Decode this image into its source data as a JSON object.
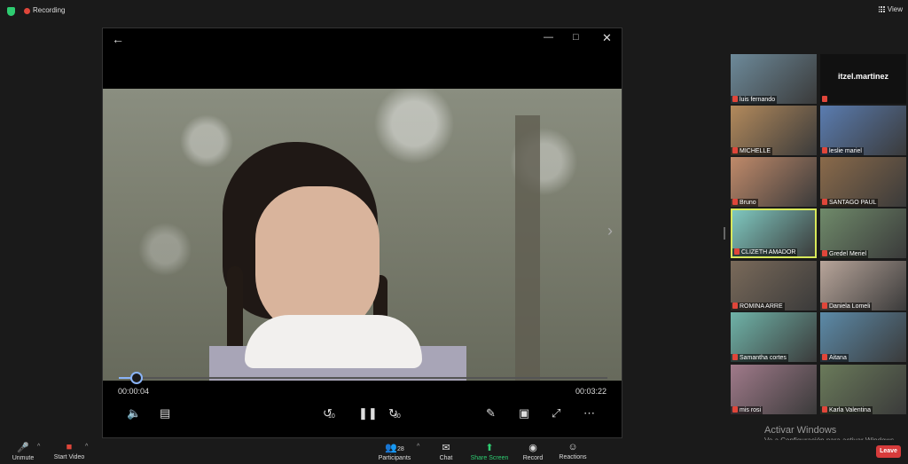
{
  "topbar": {
    "recording_label": "Recording",
    "view_label": "View"
  },
  "player": {
    "time_current": "00:00:04",
    "time_total": "00:03:22",
    "progress_fraction": 0.034,
    "skip_back_label": "10",
    "skip_forward_label": "30"
  },
  "gallery": [
    {
      "name": "luis fernando",
      "color": "#6d8a9a"
    },
    {
      "name": "itzel.martinez",
      "color": "#1a1a1a",
      "no_video": true
    },
    {
      "name": "MICHELLE",
      "color": "#b38a5c"
    },
    {
      "name": "leslie mariel",
      "color": "#5a7cb0"
    },
    {
      "name": "Bruno",
      "color": "#c08a6a"
    },
    {
      "name": "SANTAGO PAUL",
      "color": "#8a6a4a"
    },
    {
      "name": "CLIZETH AMADOR",
      "color": "#7fc8c0",
      "active": true
    },
    {
      "name": "Gredel Meriel",
      "color": "#6f8a6a"
    },
    {
      "name": "ROMINA ARRE",
      "color": "#7a6a5a"
    },
    {
      "name": "Daniela Lomeli",
      "color": "#b8a59a"
    },
    {
      "name": "Samantha cortes",
      "color": "#6fb3a8"
    },
    {
      "name": "Aitana",
      "color": "#5c8aa8"
    },
    {
      "name": "mis rosi",
      "color": "#a07a8a"
    },
    {
      "name": "Karla Valentina",
      "color": "#6a7a5a"
    }
  ],
  "toolbar": {
    "unmute": "Unmute",
    "start_video": "Start Video",
    "participants": "Participants",
    "participants_count": "28",
    "chat": "Chat",
    "share_screen": "Share Screen",
    "record": "Record",
    "reactions": "Reactions",
    "leave": "Leave"
  },
  "watermark": {
    "title": "Activar Windows",
    "subtitle": "Ve a Configuración para activar Windows."
  },
  "colors": {
    "share_green": "#2ecc71",
    "leave_red": "#d73b3b",
    "active_speaker": "#d8e85a"
  }
}
